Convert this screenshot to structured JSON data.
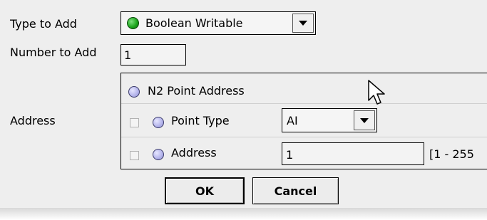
{
  "form": {
    "type_to_add_label": "Type to Add",
    "type_to_add_value": "Boolean Writable",
    "number_to_add_label": "Number to Add",
    "number_to_add_value": "1",
    "address_label": "Address"
  },
  "panel": {
    "header": "N2 Point Address",
    "point_type_label": "Point Type",
    "point_type_value": "AI",
    "address_label": "Address",
    "address_value": "1",
    "address_range": "[1 - 255"
  },
  "buttons": {
    "ok": "OK",
    "cancel": "Cancel"
  },
  "colors": {
    "status_green": "#1fa81f",
    "radio_blue": "#b7b7ec"
  },
  "icons": {
    "type_status": "green-circle-icon",
    "cursor": "mouse-pointer-icon"
  }
}
